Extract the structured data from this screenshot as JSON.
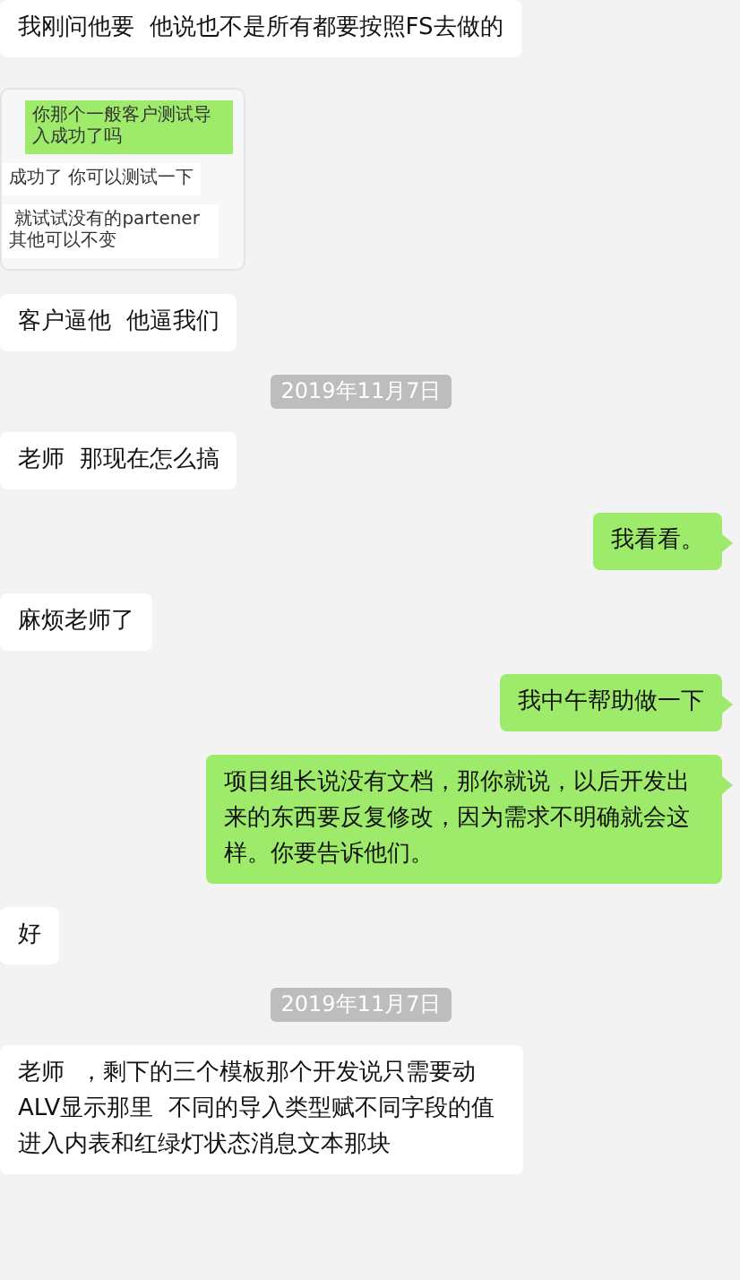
{
  "messages": [
    {
      "kind": "text",
      "outgoing": false,
      "text": "我刚问他要  他说也不是所有都要按照FS去做的"
    },
    {
      "kind": "screenshot",
      "outgoing": false,
      "bubbles": [
        {
          "outgoing": true,
          "text": "你那个一般客户测试导入成功了吗"
        },
        {
          "outgoing": false,
          "text": "成功了 你可以测试一下"
        },
        {
          "outgoing": false,
          "text": " 就试试没有的partener 其他可以不变"
        }
      ]
    },
    {
      "kind": "text",
      "outgoing": false,
      "text": "客户逼他  他逼我们"
    },
    {
      "kind": "date",
      "text": "2019年11月7日"
    },
    {
      "kind": "text",
      "outgoing": false,
      "text": "老师  那现在怎么搞"
    },
    {
      "kind": "text",
      "outgoing": true,
      "text": "我看看。"
    },
    {
      "kind": "text",
      "outgoing": false,
      "text": "麻烦老师了"
    },
    {
      "kind": "text",
      "outgoing": true,
      "text": "我中午帮助做一下"
    },
    {
      "kind": "text",
      "outgoing": true,
      "text": "项目组长说没有文档，那你就说，以后开发出来的东西要反复修改，因为需求不明确就会这样。你要告诉他们。"
    },
    {
      "kind": "text",
      "outgoing": false,
      "text": "好"
    },
    {
      "kind": "date",
      "text": "2019年11月7日"
    },
    {
      "kind": "text",
      "outgoing": false,
      "text": "老师  ，剩下的三个模板那个开发说只需要动ALV显示那里  不同的导入类型赋不同字段的值进入内表和红绿灯状态消息文本那块"
    }
  ]
}
